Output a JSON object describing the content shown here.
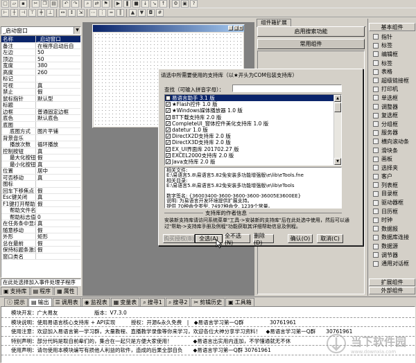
{
  "window_combo": "_启动窗口",
  "props": [
    {
      "name": "名称",
      "value": "_启动窗口",
      "sel": true
    },
    {
      "name": "备注",
      "value": "在程序启动后自"
    },
    {
      "name": "左边",
      "value": "50"
    },
    {
      "name": "顶边",
      "value": "50"
    },
    {
      "name": "宽度",
      "value": "380"
    },
    {
      "name": "高度",
      "value": "260"
    },
    {
      "name": "标记",
      "value": ""
    },
    {
      "name": "可视",
      "value": "真"
    },
    {
      "name": "禁止",
      "value": "假"
    },
    {
      "name": "鼠标指针",
      "value": "默认型"
    },
    {
      "name": "标题",
      "value": ""
    },
    {
      "name": "边框",
      "value": "普通固定边框"
    },
    {
      "name": "底色",
      "value": "默认底色"
    },
    {
      "name": "底图",
      "value": ""
    },
    {
      "name": "底图方式",
      "value": "图片平铺",
      "indent": true
    },
    {
      "name": "背景音乐",
      "value": ""
    },
    {
      "name": "播放次数",
      "value": "循环播放",
      "indent": true
    },
    {
      "name": "控制按钮",
      "value": "真"
    },
    {
      "name": "最大化按钮",
      "value": "假",
      "indent": true
    },
    {
      "name": "最小化按钮",
      "value": "真",
      "indent": true
    },
    {
      "name": "位置",
      "value": "居中"
    },
    {
      "name": "可否移动",
      "value": "真"
    },
    {
      "name": "图标",
      "value": ""
    },
    {
      "name": "回车下移焦点",
      "value": "假"
    },
    {
      "name": "Esc键关闭",
      "value": "真"
    },
    {
      "name": "F1键打开帮助",
      "value": "假"
    },
    {
      "name": "帮助文件名",
      "value": "",
      "indent": true
    },
    {
      "name": "帮助标志值",
      "value": "0",
      "indent": true
    },
    {
      "name": "在任务条中显示",
      "value": "真"
    },
    {
      "name": "随意移动",
      "value": "假"
    },
    {
      "name": "外形",
      "value": "矩形"
    },
    {
      "name": "总在最前",
      "value": "假"
    },
    {
      "name": "保持标题条激活",
      "value": "假"
    },
    {
      "name": "窗口类名",
      "value": ""
    }
  ],
  "props_event_combo": "在此处选择加入事件处理子程序",
  "left_tabs": [
    {
      "label": "支持库",
      "icon": "▣"
    },
    {
      "label": "程序",
      "icon": "▤"
    },
    {
      "label": "属性",
      "icon": "▦"
    }
  ],
  "right_panel": {
    "tab": "组件箱扩展",
    "btn1": "启用搜索功能",
    "btn2": "常用组件"
  },
  "components": {
    "header": "基本组件",
    "items": [
      "指针",
      "标签",
      "编辑框",
      "标签",
      "表格",
      "超级链接框",
      "打印机",
      "单选框",
      "调整器",
      "复选框",
      "分组框",
      "服务器",
      "横向滚动条",
      "滑块条",
      "画板",
      "选择夹",
      "客户",
      "列表框",
      "目录框",
      "驱动器框",
      "日历框",
      "时钟",
      "数据报",
      "数据库连接",
      "数据源",
      "调节器",
      "通用对话框"
    ],
    "footer1": "扩展组件",
    "footer2": "外部组件"
  },
  "dialog": {
    "title": "请选中所需要使用的支持库（以★开头为COM包装支持库）",
    "search_label": "查找（可输入拼音字母）：",
    "libs": [
      {
        "label": "易语言助手 3.1 版",
        "checked": true,
        "sel": true
      },
      {
        "label": "★Flash控件 1.0 版",
        "checked": true
      },
      {
        "label": "★Windows媒体播放器 1.0 版",
        "checked": true
      },
      {
        "label": "BT下载支持库 2.0 版",
        "checked": true
      },
      {
        "label": "CompleteUI_窗体控件美化支持库 1.0 版",
        "checked": true
      },
      {
        "label": "datetur 1.0 版",
        "checked": true
      },
      {
        "label": "DirectX2D支持库 2.0 版",
        "checked": true
      },
      {
        "label": "DirectX3D支持库 2.0 版",
        "checked": true
      },
      {
        "label": "EX_UI界面库 201702.27 版",
        "checked": true
      },
      {
        "label": "EXCEL2000支持库 2.0 版",
        "checked": true
      },
      {
        "label": "Java支持库 2.0 版",
        "checked": true
      },
      {
        "label": "jedi 1.0 版",
        "checked": true
      }
    ],
    "info_lines": [
      "相关文件:",
      "E:\\易语言5.8\\易语言5.82免安装多功能增强版\\e\\lib\\eTools.fne",
      "相关目录:",
      "E:\\易语言5.8\\易语言5.82免安装多功能增强版\\e\\lib\\eTools",
      "",
      "数字签名: {36003400-3600-3600-3600-36005E3600EE}",
      "说明: 为易语言开发环境提供扩展支持。",
      "提供 70种命令类型, 7497种命令, 1239个常量。"
    ],
    "group_label": "支持库的作者信息",
    "desc": "安装新支持库请访问系统菜单\"工具->安装新的支持库\"后在此处选中使用，然后可以通过\"帮助->支持库手册及例程\"功能获取其详细帮助信息及例程。",
    "buttons": {
      "buy": "购买授权(B)",
      "select_all": "全选(A)",
      "unselect_all": "全不选(N)",
      "delete": "删除(D)",
      "ok": "确认(O)",
      "cancel": "取消(C)"
    }
  },
  "bottom_tabs": [
    {
      "label": "提示",
      "icon": "ⓘ"
    },
    {
      "label": "输出",
      "icon": "▤"
    },
    {
      "label": "调用表",
      "icon": "☰"
    },
    {
      "label": "监视表",
      "icon": "◉"
    },
    {
      "label": "变量表",
      "icon": "▦"
    },
    {
      "label": "搜寻1",
      "icon": "⌕"
    },
    {
      "label": "搜寻2",
      "icon": "⌕"
    },
    {
      "label": "剪辑历史",
      "icon": "✂"
    },
    {
      "label": "工具箱",
      "icon": "▣"
    }
  ],
  "output_lines": [
    "模块开发：广大易友　　　　　　　版本：V7.3.0",
    "模块说明：使用易语言核心支持库 + API实现　　　授权：开源&永久免费　|　◆易语言学习第一Q群　　　　　30761961",
    "使用注意：欢迎加入易语言第一学习群，大量教程、直播教学录像等你来学习，欢迎各位大神分享学习资料！　◆易语言学习第一Q群　　30761961",
    "特别声明：部分代码是取自前辈们的，集合在一起只是方便大家使用！　　　　◆易语言出实用内连加，不学懂通就无不休",
    "使用声明：请勿使用本模块编写有损他人利益的软件，造成的后果全部自负　　◆易语言学习第一Q群 30761961"
  ],
  "watermark": "当下软件园",
  "watermark_url": "www.downxia.com"
}
